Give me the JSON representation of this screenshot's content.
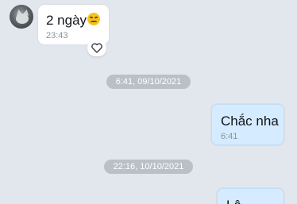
{
  "colors": {
    "background": "#e2e7ee",
    "incoming_bubble": "#ffffff",
    "outgoing_bubble": "#d5ebff",
    "divider": "#b9c0c8"
  },
  "messages": [
    {
      "direction": "incoming",
      "text": "2 ngày",
      "emoji": "sad-face-emoji",
      "time": "23:43",
      "reaction_icon": "heart-outline-icon"
    },
    {
      "direction": "outgoing",
      "text": "Chắc nha",
      "time": "6:41"
    },
    {
      "direction": "outgoing",
      "text": "Lâ..."
    }
  ],
  "date_dividers": [
    "6:41, 09/10/2021",
    "22:16, 10/10/2021"
  ]
}
